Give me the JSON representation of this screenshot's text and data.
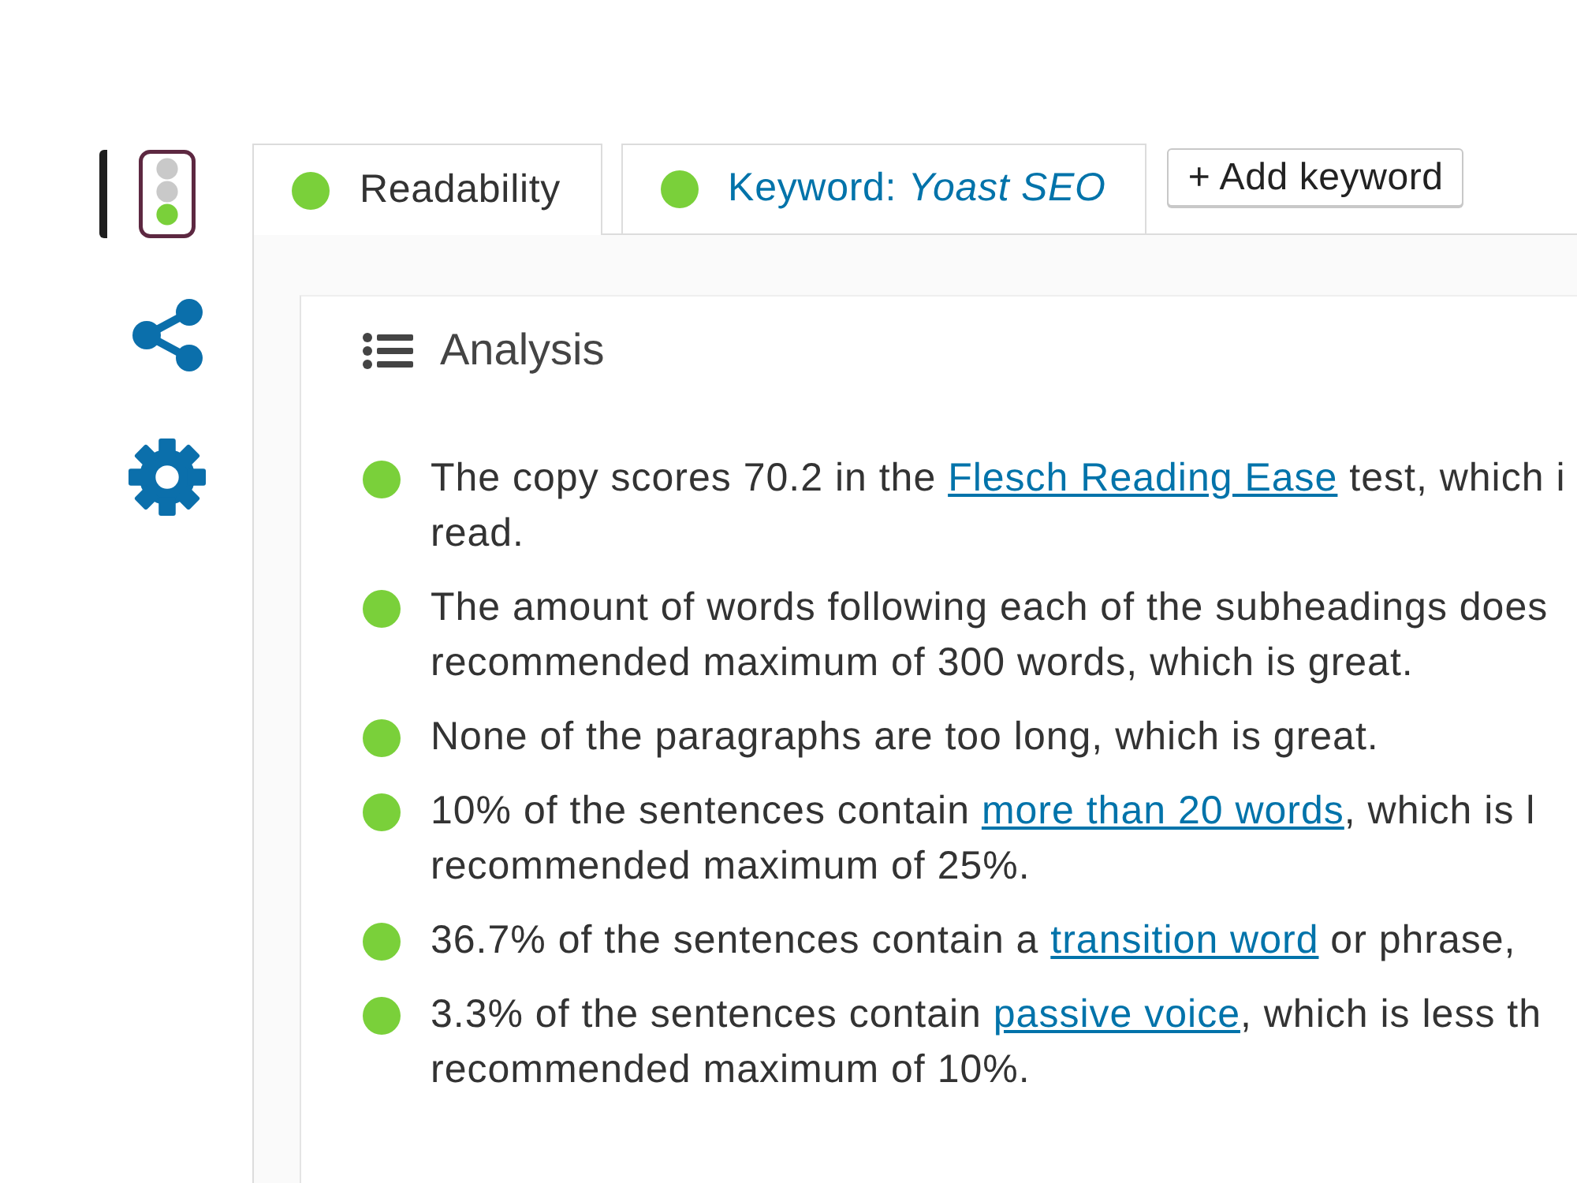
{
  "sidebar": {
    "items": [
      {
        "kind": "readability",
        "selected": true
      },
      {
        "kind": "social",
        "selected": false
      },
      {
        "kind": "settings",
        "selected": false
      }
    ]
  },
  "tabs": [
    {
      "label": "Readability",
      "selected": true,
      "color": "#7ad03a"
    },
    {
      "label": "Keyword: *Yoast SEO*",
      "selected": false,
      "color": "#7ad03a"
    }
  ],
  "add_button": {
    "label": "+ Add keyword"
  },
  "analysis": {
    "title": "Analysis",
    "results": [
      {
        "color": "#7ad03a",
        "lines": [
          [
            {
              "kind": "text",
              "text": "The copy scores 70.2 in the "
            },
            {
              "kind": "link",
              "text": "Flesch Reading Ease"
            },
            {
              "kind": "text",
              "text": " test, which i"
            }
          ],
          [
            {
              "kind": "text",
              "text": "read."
            }
          ]
        ]
      },
      {
        "color": "#7ad03a",
        "lines": [
          [
            {
              "kind": "text",
              "text": "The amount of words following each of the subheadings does"
            }
          ],
          [
            {
              "kind": "text",
              "text": "recommended maximum of 300 words, which is great."
            }
          ]
        ]
      },
      {
        "color": "#7ad03a",
        "lines": [
          [
            {
              "kind": "text",
              "text": "None of the paragraphs are too long, which is great."
            }
          ]
        ]
      },
      {
        "color": "#7ad03a",
        "lines": [
          [
            {
              "kind": "text",
              "text": "10% of the sentences contain "
            },
            {
              "kind": "link",
              "text": "more than 20 words"
            },
            {
              "kind": "text",
              "text": ", which is l"
            }
          ],
          [
            {
              "kind": "text",
              "text": "recommended maximum of 25%."
            }
          ]
        ]
      },
      {
        "color": "#7ad03a",
        "lines": [
          [
            {
              "kind": "text",
              "text": "36.7% of the sentences contain a "
            },
            {
              "kind": "link",
              "text": "transition word"
            },
            {
              "kind": "text",
              "text": " or phrase,"
            }
          ]
        ]
      },
      {
        "color": "#7ad03a",
        "lines": [
          [
            {
              "kind": "text",
              "text": "3.3% of the sentences contain "
            },
            {
              "kind": "link",
              "text": "passive voice"
            },
            {
              "kind": "text",
              "text": ", which is less th"
            }
          ],
          [
            {
              "kind": "text",
              "text": "recommended maximum of 10%."
            }
          ]
        ]
      }
    ]
  }
}
